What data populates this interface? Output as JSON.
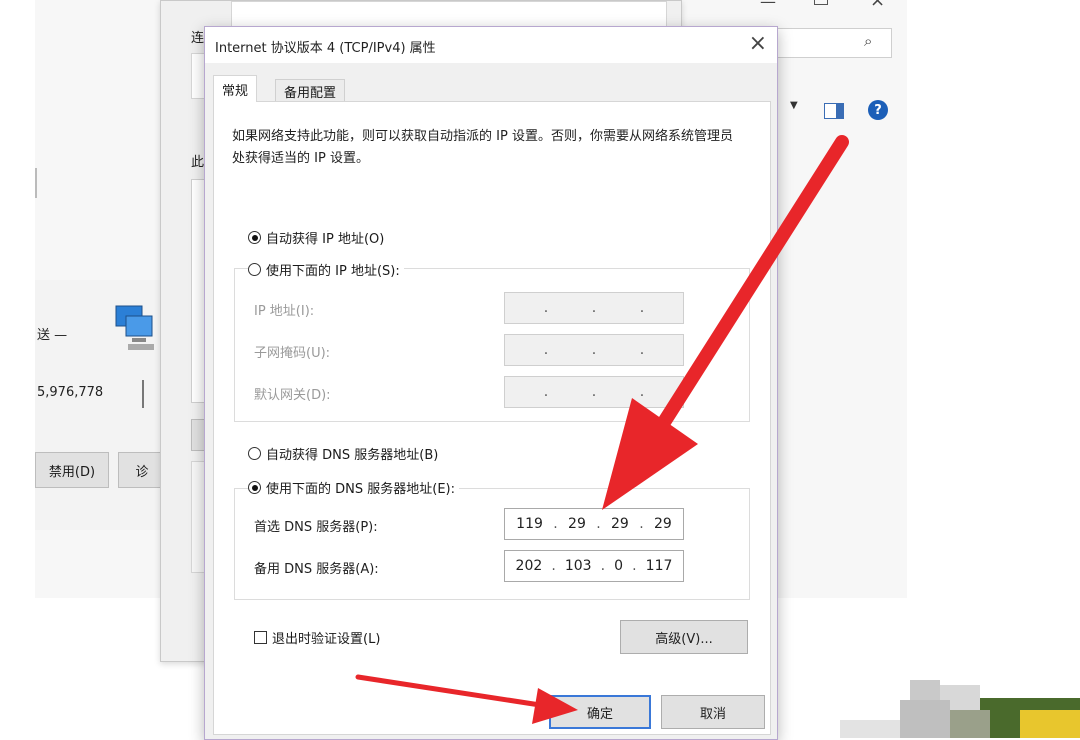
{
  "background": {
    "left_label_sent": "送 —",
    "left_value": "5,976,778",
    "disable_button": "禁用(D)",
    "diagnose_button": "诊",
    "mid_label_connect": "连",
    "mid_label_this": "此",
    "search_icon": "search-icon"
  },
  "dialog": {
    "title": "Internet 协议版本 4 (TCP/IPv4) 属性",
    "tabs": [
      "常规",
      "备用配置"
    ],
    "description": "如果网络支持此功能，则可以获取自动指派的 IP 设置。否则，你需要从网络系统管理员处获得适当的 IP 设置。",
    "ip": {
      "auto_label": "自动获得 IP 地址(O)",
      "manual_label": "使用下面的 IP 地址(S):",
      "selected": "auto",
      "fields": [
        {
          "label": "IP 地址(I):",
          "value": [
            "",
            "",
            "",
            ""
          ]
        },
        {
          "label": "子网掩码(U):",
          "value": [
            "",
            "",
            "",
            ""
          ]
        },
        {
          "label": "默认网关(D):",
          "value": [
            "",
            "",
            "",
            ""
          ]
        }
      ]
    },
    "dns": {
      "auto_label": "自动获得 DNS 服务器地址(B)",
      "manual_label": "使用下面的 DNS 服务器地址(E):",
      "selected": "manual",
      "preferred_label": "首选 DNS 服务器(P):",
      "preferred_value": [
        "119",
        "29",
        "29",
        "29"
      ],
      "alternate_label": "备用 DNS 服务器(A):",
      "alternate_value": [
        "202",
        "103",
        "0",
        "117"
      ]
    },
    "validate_label": "退出时验证设置(L)",
    "validate_checked": false,
    "advanced_button": "高级(V)...",
    "ok_button": "确定",
    "cancel_button": "取消"
  },
  "colors": {
    "arrow": "#e8262a",
    "default_button_border": "#3a78d8"
  }
}
